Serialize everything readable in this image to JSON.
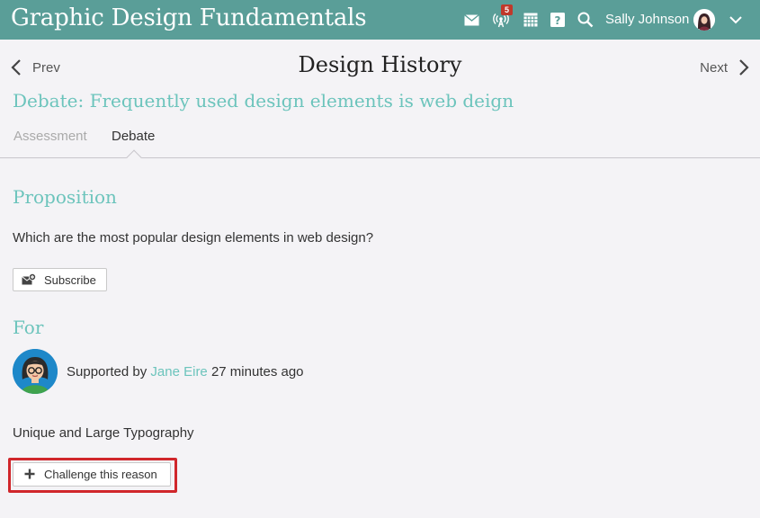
{
  "header": {
    "app_title": "Graphic Design Fundamentals",
    "notification_count": "5",
    "user_name": "Sally Johnson",
    "icons": [
      "mail-icon",
      "broadcast-icon",
      "calendar-icon",
      "help-icon",
      "search-icon",
      "chevron-down-icon"
    ]
  },
  "nav": {
    "prev_label": "Prev",
    "next_label": "Next",
    "page_title": "Design History"
  },
  "debate": {
    "title": "Debate: Frequently used design elements is web deign"
  },
  "tabs": [
    {
      "label": "Assessment",
      "active": false
    },
    {
      "label": "Debate",
      "active": true
    }
  ],
  "proposition": {
    "heading": "Proposition",
    "text": "Which are the most popular design elements in web design?",
    "subscribe_label": "Subscribe"
  },
  "for_section": {
    "heading": "For",
    "supported_prefix": "Supported by",
    "author": "Jane Eire",
    "time_ago": "27 minutes ago",
    "reason": "Unique and Large Typography",
    "challenge_label": "Challenge this reason"
  },
  "colors": {
    "header_bg": "#5a9e98",
    "accent": "#6cc4bc",
    "highlight": "#d0262b",
    "badge": "#c0392b"
  }
}
